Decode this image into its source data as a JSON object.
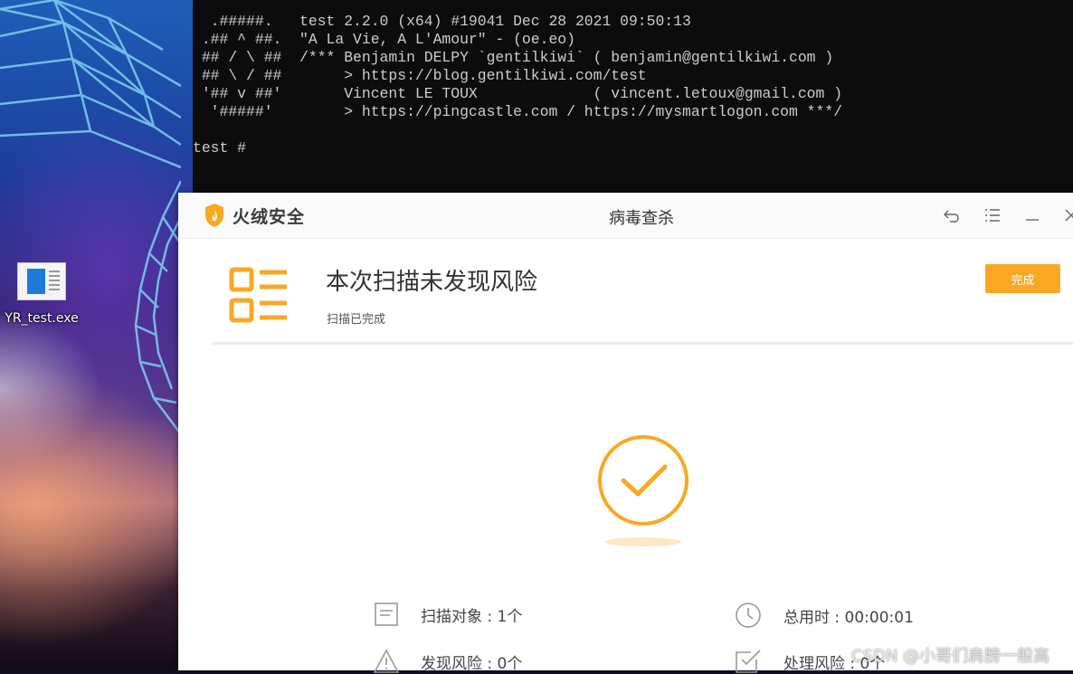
{
  "terminal": {
    "lines": [
      "  .#####.   test 2.2.0 (x64) #19041 Dec 28 2021 09:50:13",
      " .## ^ ##.  \"A La Vie, A L'Amour\" - (oe.eo)",
      " ## / \\ ##  /*** Benjamin DELPY `gentilkiwi` ( benjamin@gentilkiwi.com )",
      " ## \\ / ##       > https://blog.gentilkiwi.com/test",
      " '## v ##'       Vincent LE TOUX             ( vincent.letoux@gmail.com )",
      "  '#####'        > https://pingcastle.com / https://mysmartlogon.com ***/",
      "",
      "test #"
    ]
  },
  "desktop": {
    "icon_label": "YR_test.exe"
  },
  "app": {
    "brand": "火绒安全",
    "window_title": "病毒查杀",
    "accent_color": "#f9a825",
    "result_title": "本次扫描未发现风险",
    "result_subtitle": "扫描已完成",
    "done_button": "完成",
    "stats": [
      {
        "label": "扫描对象 : 1个",
        "icon": "document-icon"
      },
      {
        "label": "总用时 : 00:00:01",
        "icon": "clock-icon"
      },
      {
        "label": "发现风险 : 0个",
        "icon": "warning-icon"
      },
      {
        "label": "处理风险 : 0个",
        "icon": "checkbox-icon"
      }
    ]
  },
  "watermark": "CSDN @小哥们肩膀一般高"
}
